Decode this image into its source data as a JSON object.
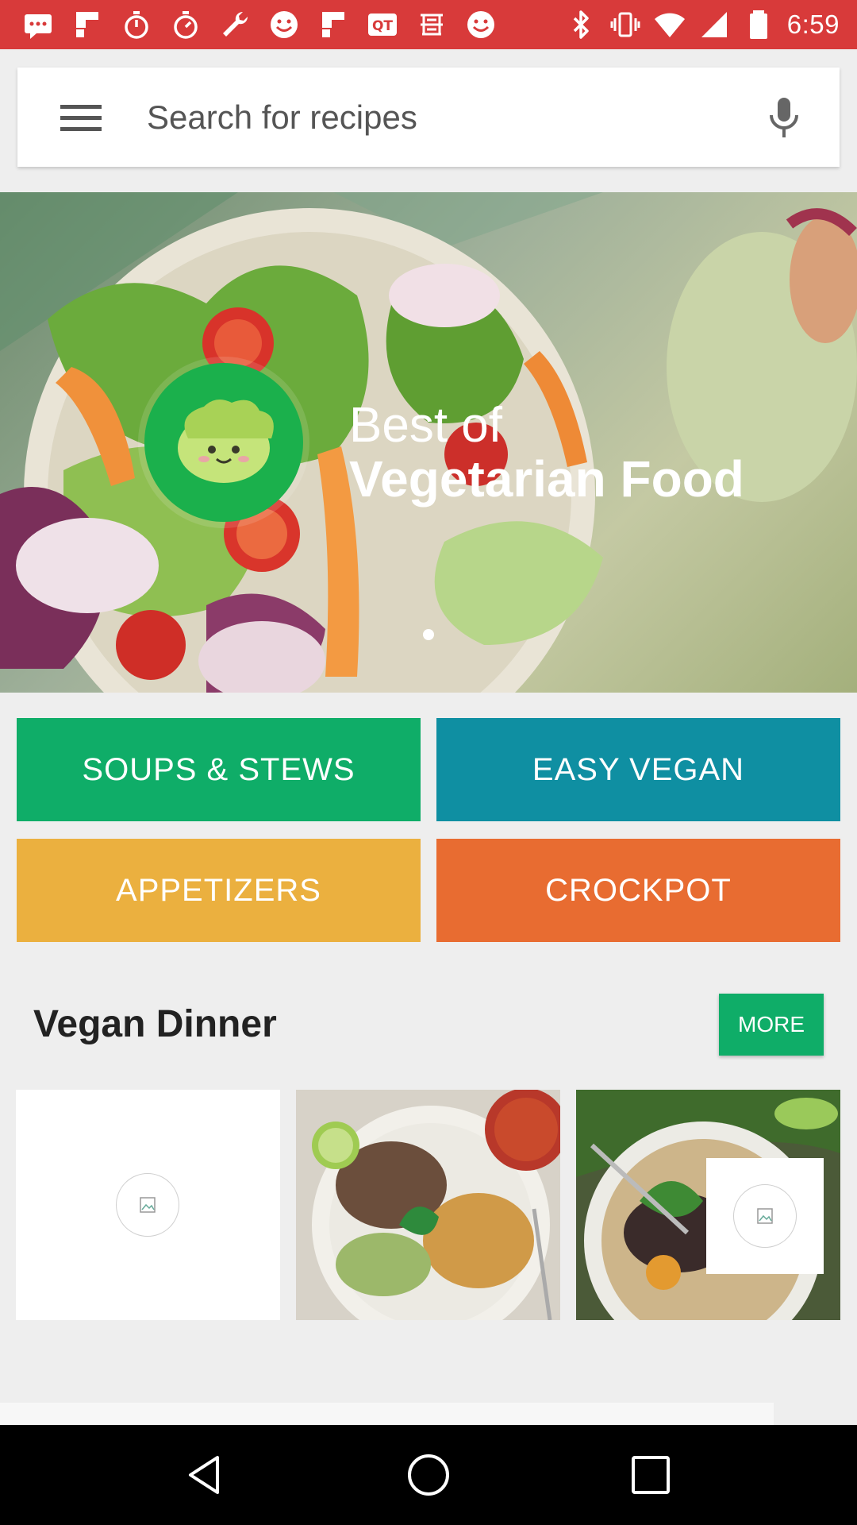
{
  "status_bar": {
    "time": "6:59",
    "icons": [
      "messages-icon",
      "flipboard-icon",
      "stopwatch-icon",
      "stopwatch-icon",
      "wrench-icon",
      "smiley-icon",
      "flipboard-icon",
      "qt-icon",
      "chinese-app-icon",
      "smiley-icon",
      "bluetooth-icon",
      "vibrate-icon",
      "wifi-icon",
      "signal-icon",
      "battery-icon"
    ],
    "background": "#d83a3a"
  },
  "search": {
    "placeholder": "Search for recipes"
  },
  "hero": {
    "line1": "Best of",
    "line2": "Vegetarian Food",
    "page_count": 1,
    "active_page": 1
  },
  "categories": [
    {
      "label": "SOUPS & STEWS",
      "color": "#0fad68"
    },
    {
      "label": "EASY VEGAN",
      "color": "#0f8fa2"
    },
    {
      "label": "APPETIZERS",
      "color": "#ebb03f"
    },
    {
      "label": "CROCKPOT",
      "color": "#e86c31"
    }
  ],
  "section": {
    "title": "Vegan Dinner",
    "more_label": "MORE"
  },
  "nav": {
    "icons": [
      "back-icon",
      "home-icon",
      "recents-icon"
    ]
  }
}
